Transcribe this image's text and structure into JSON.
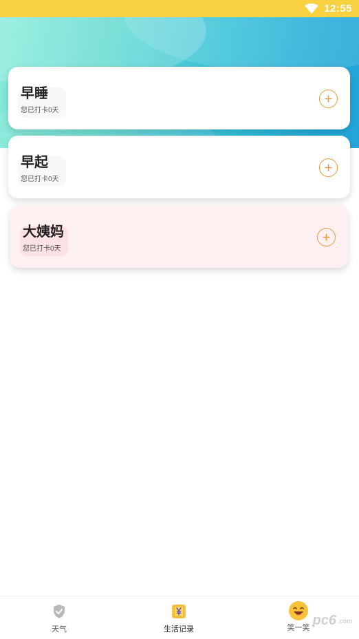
{
  "status_bar": {
    "time": "12:55",
    "wifi_icon": "wifi-icon",
    "color": "#f7d13f"
  },
  "records": [
    {
      "title": "早睡",
      "subtitle": "您已打卡0天",
      "add_icon": "plus-circle-icon"
    },
    {
      "title": "早起",
      "subtitle": "您已打卡0天",
      "add_icon": "plus-circle-icon"
    },
    {
      "title": "大姨妈",
      "subtitle": "您已打卡0天",
      "add_icon": "plus-circle-icon"
    }
  ],
  "tabbar": {
    "tabs": [
      {
        "label": "天气",
        "icon": "shield-check-icon"
      },
      {
        "label": "生活记录",
        "icon": "yuan-ticket-icon",
        "active": true
      },
      {
        "label": "笑一笑",
        "icon": "laughing-emoji-icon"
      }
    ]
  },
  "watermark": {
    "text": "pc6",
    "suffix": ".com"
  },
  "colors": {
    "accent": "#f0963c",
    "hero_start": "#86ecd9",
    "hero_end": "#22a4d8",
    "pink_card": "#fff1f2"
  }
}
